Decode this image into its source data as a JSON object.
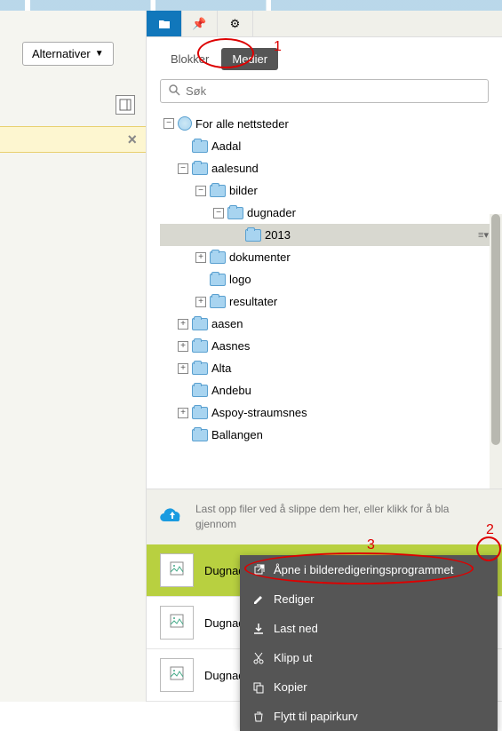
{
  "left": {
    "options_label": "Alternativer"
  },
  "tabs": {
    "blocks": "Blokker",
    "media": "Medier"
  },
  "search": {
    "placeholder": "Søk"
  },
  "tree": {
    "root": "For alle nettsteder",
    "items": [
      {
        "label": "Aadal",
        "indent": 1,
        "exp": ""
      },
      {
        "label": "aalesund",
        "indent": 1,
        "exp": "-"
      },
      {
        "label": "bilder",
        "indent": 2,
        "exp": "-"
      },
      {
        "label": "dugnader",
        "indent": 3,
        "exp": "-"
      },
      {
        "label": "2013",
        "indent": 4,
        "exp": "",
        "selected": true,
        "menu": true
      },
      {
        "label": "dokumenter",
        "indent": 2,
        "exp": "+"
      },
      {
        "label": "logo",
        "indent": 2,
        "exp": ""
      },
      {
        "label": "resultater",
        "indent": 2,
        "exp": "+"
      },
      {
        "label": "aasen",
        "indent": 1,
        "exp": "+"
      },
      {
        "label": "Aasnes",
        "indent": 1,
        "exp": "+"
      },
      {
        "label": "Alta",
        "indent": 1,
        "exp": "+"
      },
      {
        "label": "Andebu",
        "indent": 1,
        "exp": ""
      },
      {
        "label": "Aspoy-straumsnes",
        "indent": 1,
        "exp": "+"
      },
      {
        "label": "Ballangen",
        "indent": 1,
        "exp": ""
      }
    ]
  },
  "upload_text": "Last opp filer ved å slippe dem her, eller klikk for å bla gjennom",
  "files": [
    {
      "name": "Dugnad",
      "selected": true
    },
    {
      "name": "Dugnad",
      "selected": false
    },
    {
      "name": "Dugnad",
      "selected": false
    }
  ],
  "context_menu": [
    {
      "icon": "open",
      "label": "Åpne i bilderedigeringsprogrammet"
    },
    {
      "icon": "edit",
      "label": "Rediger"
    },
    {
      "icon": "download",
      "label": "Last ned"
    },
    {
      "icon": "cut",
      "label": "Klipp ut"
    },
    {
      "icon": "copy",
      "label": "Kopier"
    },
    {
      "icon": "trash",
      "label": "Flytt til papirkurv"
    }
  ],
  "annotations": {
    "a1": "1",
    "a2": "2",
    "a3": "3"
  }
}
